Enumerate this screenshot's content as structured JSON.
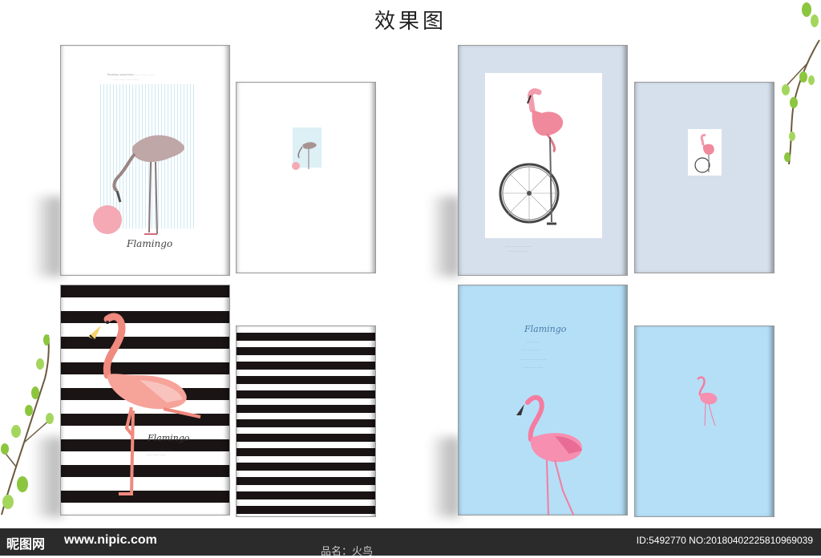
{
  "page_title": "效果图",
  "covers": {
    "white_large": {
      "script_text": "Flamingo"
    },
    "stripes_large": {
      "script_text": "Flamingo"
    },
    "sky_large": {
      "script_text": "Flamingo"
    }
  },
  "footer": {
    "logo": "昵图网",
    "url": "www.nipic.com",
    "id_text": "ID:5492770 NO:20180402225810969039",
    "product_name": "品名：火鸟"
  },
  "colors": {
    "grey_cover": "#d6e0ec",
    "sky_cover": "#b5dff7",
    "flamingo_pink": "#f08a9a",
    "stripe_dark": "#1a1414"
  }
}
